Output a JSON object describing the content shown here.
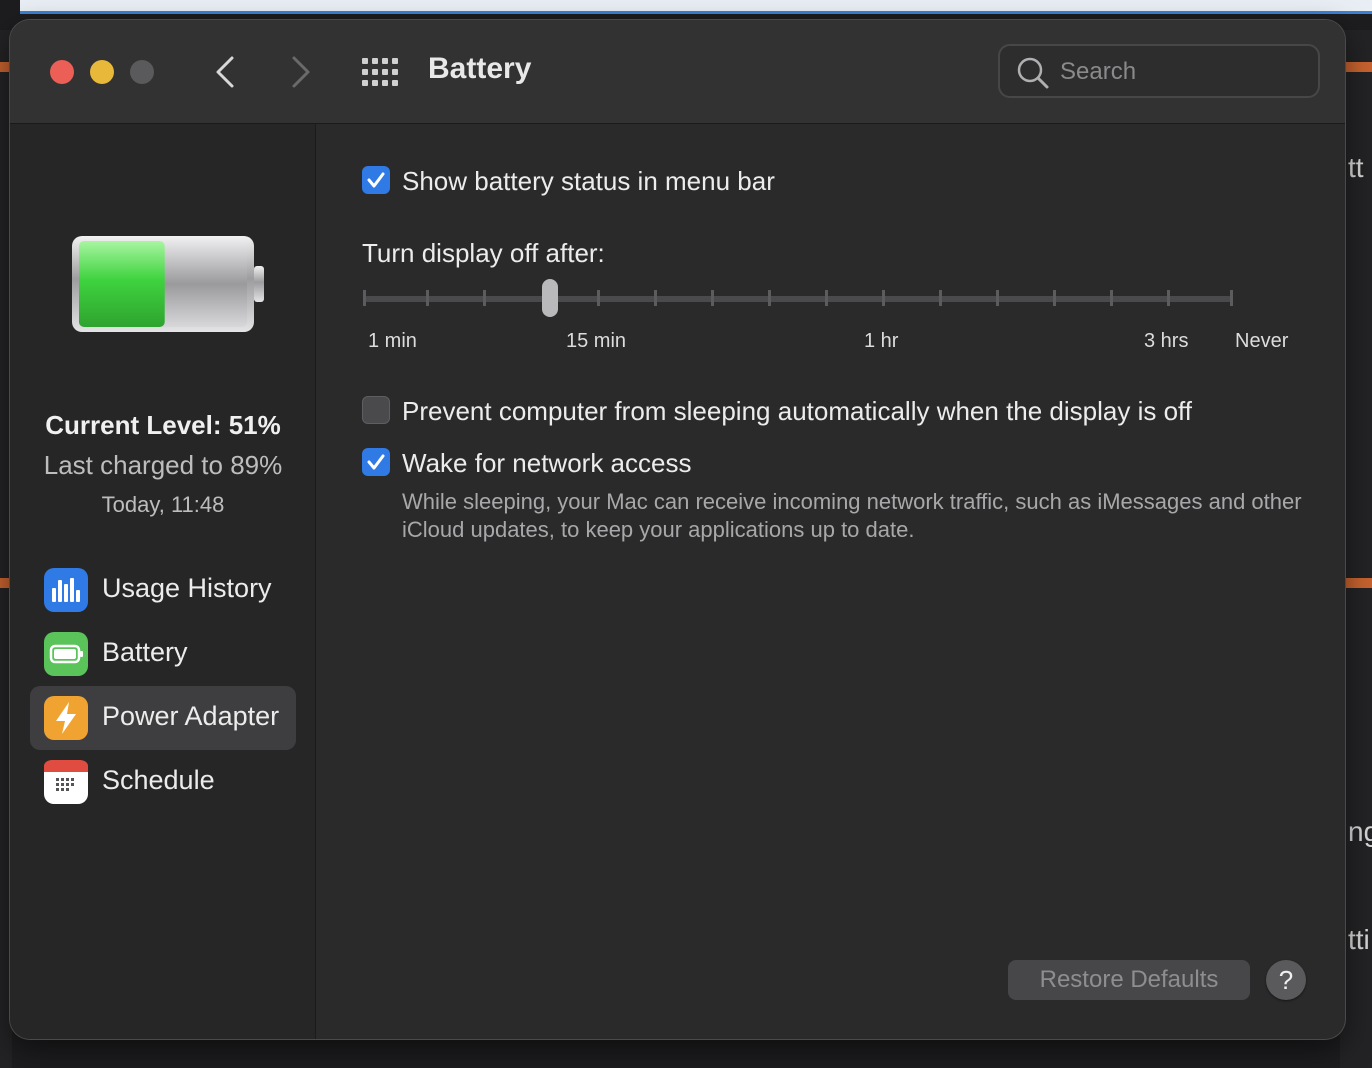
{
  "window": {
    "title": "Battery"
  },
  "search": {
    "placeholder": "Search"
  },
  "sidebar": {
    "battery_level_percent": 51,
    "current_level": "Current Level: 51%",
    "last_charged": "Last charged to 89%",
    "charged_time": "Today, 11:48",
    "items": [
      {
        "label": "Usage History",
        "icon": "bar-chart-icon",
        "color": "#2f7ae5",
        "selected": false
      },
      {
        "label": "Battery",
        "icon": "battery-icon",
        "color": "#5ac35a",
        "selected": false
      },
      {
        "label": "Power Adapter",
        "icon": "lightning-bolt-icon",
        "color": "#f0a330",
        "selected": true
      },
      {
        "label": "Schedule",
        "icon": "calendar-icon",
        "color": "#ffffff",
        "selected": false
      }
    ]
  },
  "content": {
    "show_battery_status": {
      "label": "Show battery status in menu bar",
      "checked": true
    },
    "display_off": {
      "label": "Turn display off after:",
      "tick_labels": [
        "1 min",
        "15 min",
        "1 hr",
        "3 hrs",
        "Never"
      ],
      "value": "10 min"
    },
    "prevent_sleep": {
      "label": "Prevent computer from sleeping automatically when the display is off",
      "checked": false
    },
    "wake_network": {
      "label": "Wake for network access",
      "checked": true,
      "description": "While sleeping, your Mac can receive incoming network traffic, such as iMessages and other iCloud updates, to keep your applications up to date."
    },
    "restore_defaults": "Restore Defaults",
    "help": "?"
  },
  "background": {
    "fragments": [
      "tt",
      "ng",
      "tti"
    ]
  },
  "colors": {
    "accent": "#2f7ae5",
    "battery_green": "#3fd33f",
    "close": "#ec5f56",
    "minimize": "#e8b83a"
  }
}
